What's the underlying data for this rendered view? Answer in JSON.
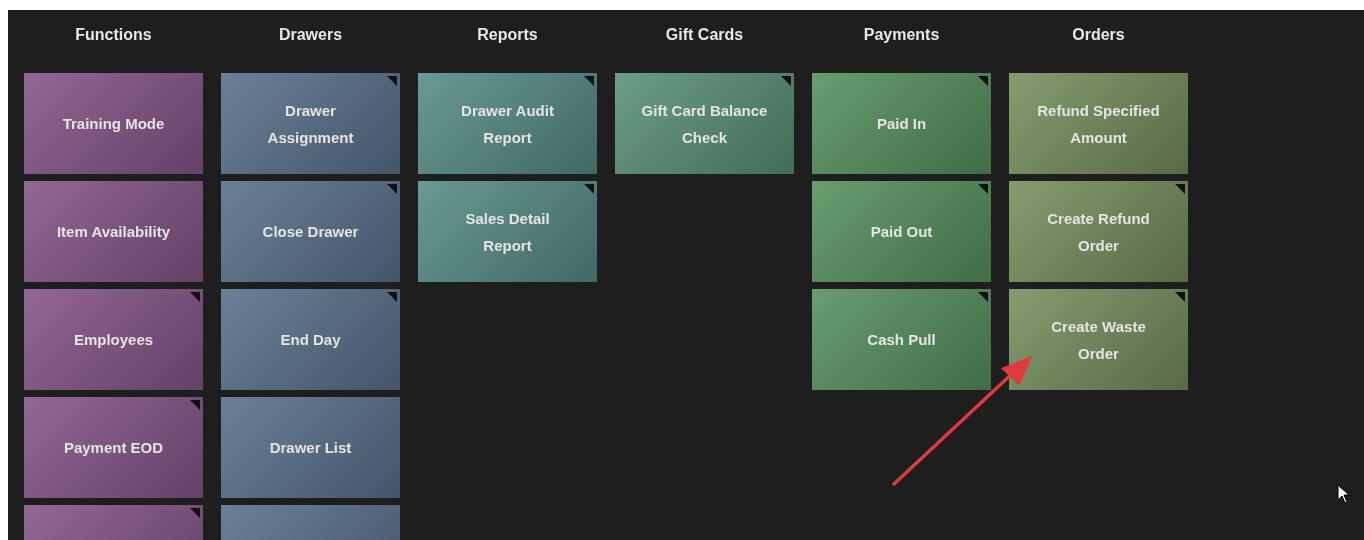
{
  "columns": [
    {
      "title": "Functions",
      "color": "#8a5a8c",
      "tiles": [
        {
          "label": "Training Mode",
          "marker": false
        },
        {
          "label": "Item Availability",
          "marker": false
        },
        {
          "label": "Employees",
          "marker": true
        },
        {
          "label": "Payment EOD",
          "marker": true
        },
        {
          "marker": true
        }
      ]
    },
    {
      "title": "Drawers",
      "color": "#5e7690",
      "tiles": [
        {
          "label": "Drawer Assignment",
          "marker": true
        },
        {
          "label": "Close Drawer",
          "marker": true
        },
        {
          "label": "End Day",
          "marker": true
        },
        {
          "label": "Drawer List",
          "marker": false
        },
        {
          "marker": false
        }
      ]
    },
    {
      "title": "Reports",
      "color": "#5c918b",
      "tiles": [
        {
          "label": "Drawer Audit Report",
          "marker": true
        },
        {
          "label": "Sales Detail Report",
          "marker": true
        }
      ]
    },
    {
      "title": "Gift Cards",
      "color": "#5f957c",
      "tiles": [
        {
          "label": "Gift Card Balance Check",
          "marker": true
        }
      ]
    },
    {
      "title": "Payments",
      "color": "#5b9662",
      "tiles": [
        {
          "label": "Paid In",
          "marker": true
        },
        {
          "label": "Paid Out",
          "marker": true
        },
        {
          "label": "Cash Pull",
          "marker": true
        }
      ]
    },
    {
      "title": "Orders",
      "color": "#7a9462",
      "tiles": [
        {
          "label": "Refund Specified Amount",
          "marker": false
        },
        {
          "label": "Create Refund Order",
          "marker": true
        },
        {
          "label": "Create Waste Order",
          "marker": true
        }
      ]
    }
  ]
}
